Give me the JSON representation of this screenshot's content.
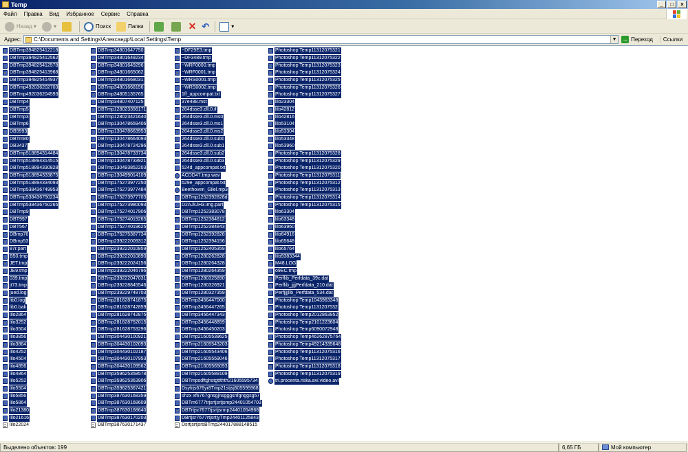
{
  "window": {
    "title": "Temp"
  },
  "menu": [
    "Файл",
    "Правка",
    "Вид",
    "Избранное",
    "Сервис",
    "Справка"
  ],
  "toolbar": {
    "back": "Назад",
    "search": "Поиск",
    "folders": "Папки"
  },
  "address": {
    "label": "Адрес:",
    "path": "C:\\Documents and Settings\\Александр\\Local Settings\\Temp",
    "go": "Переход",
    "links": "Ссылки"
  },
  "colors": {
    "selection": "#0a246a",
    "titlebar": "#0a246a",
    "face": "#ece9d8"
  },
  "columns": [
    [
      {
        "n": "DBTmp394825412218",
        "s": true
      },
      {
        "n": "DBTmp394825412562",
        "s": true
      },
      {
        "n": "DBTmp394825412578",
        "s": true
      },
      {
        "n": "DBTmp394825413968",
        "s": true
      },
      {
        "n": "DBTmp394825414937",
        "s": true
      },
      {
        "n": "DBTmp492036202703",
        "s": true
      },
      {
        "n": "DBTmp492036204593",
        "s": true
      },
      {
        "n": "DBTmp4",
        "s": true
      },
      {
        "n": "DBTmp5",
        "s": true
      },
      {
        "n": "DBTmp3",
        "s": true
      },
      {
        "n": "DBTmp6",
        "s": true
      },
      {
        "n": "DB9993",
        "s": true
      },
      {
        "n": "DBTm80",
        "s": true
      },
      {
        "n": "DB3437",
        "s": true
      },
      {
        "n": "DBTmp518894314484",
        "s": true
      },
      {
        "n": "DBTmp518894314515",
        "s": true
      },
      {
        "n": "DBTmp518894330828",
        "s": true
      },
      {
        "n": "DBTmp518894333875",
        "s": true
      },
      {
        "n": "DBTmp518894334093",
        "s": true
      },
      {
        "n": "DBTmp538436749953",
        "s": true
      },
      {
        "n": "DBTmp538436750234",
        "s": true
      },
      {
        "n": "DBTmp538436750265",
        "s": true
      },
      {
        "n": "DBTmp9",
        "s": true
      },
      {
        "n": "DBT997",
        "s": true
      },
      {
        "n": "DBT567",
        "s": true
      },
      {
        "n": "DBmp76",
        "s": true
      },
      {
        "n": "DBmp53",
        "s": true
      },
      {
        "n": "87r.part",
        "s": true
      },
      {
        "n": "B50.tmp",
        "s": true
      },
      {
        "n": "JET.tmp",
        "s": true
      },
      {
        "n": "JE9.tmp",
        "s": true
      },
      {
        "n": "039.tmp",
        "s": true
      },
      {
        "n": "jt73.tmp",
        "s": true
      },
      {
        "n": "jued.log",
        "s": true
      },
      {
        "n": "lib0.log",
        "s": true
      },
      {
        "n": "lib0.bak",
        "s": true
      },
      {
        "n": "lilo2864",
        "s": true
      },
      {
        "n": "lilo3252",
        "s": true
      },
      {
        "n": "lilo3504",
        "s": true
      },
      {
        "n": "lilo3856",
        "s": true
      },
      {
        "n": "lilo3864",
        "s": true
      },
      {
        "n": "lilo4252",
        "s": true
      },
      {
        "n": "lilo4504",
        "s": true
      },
      {
        "n": "lilo4856",
        "s": true
      },
      {
        "n": "lilo4864",
        "s": true
      },
      {
        "n": "lilo5252",
        "s": true
      },
      {
        "n": "lilo5504",
        "s": true
      },
      {
        "n": "lilo5856",
        "s": true
      },
      {
        "n": "lilo5864",
        "s": true
      },
      {
        "n": "lilo21380",
        "s": true
      },
      {
        "n": "lilo21616",
        "s": true
      },
      {
        "n": "lilo22024",
        "s": false
      }
    ],
    [
      {
        "n": "DBTmp34801647750",
        "s": true
      },
      {
        "n": "DBTmp34801649234",
        "s": true
      },
      {
        "n": "DBTmp34801649296",
        "s": true
      },
      {
        "n": "DBTmp34801665062",
        "s": true
      },
      {
        "n": "DBTmp34801668031",
        "s": true
      },
      {
        "n": "DBTmp34801668156",
        "s": true
      },
      {
        "n": "DBTmp34805135765",
        "s": true
      },
      {
        "n": "DBTmp34807407125",
        "s": true
      },
      {
        "n": "DBTmp128023356171",
        "s": true
      },
      {
        "n": "DBTmp128023421640",
        "s": true
      },
      {
        "n": "DBTmp130478659406",
        "s": true
      },
      {
        "n": "DBTmp130478663953",
        "s": true
      },
      {
        "n": "DBTmp130478664093",
        "s": true
      },
      {
        "n": "DBTmp130478724296",
        "s": true
      },
      {
        "n": "DBTmp130478733734",
        "s": true
      },
      {
        "n": "DBTmp130478733921",
        "s": true
      },
      {
        "n": "DBTmp130493852203",
        "s": true
      },
      {
        "n": "DBTmp130499014109",
        "s": true
      },
      {
        "n": "DBTmp175273977250",
        "s": true
      },
      {
        "n": "DBTmp175273977484",
        "s": true
      },
      {
        "n": "DBTmp175273977703",
        "s": true
      },
      {
        "n": "DBTmp175273980093",
        "s": true
      },
      {
        "n": "DBTmp175274017906",
        "s": true
      },
      {
        "n": "DBTmp175274019265",
        "s": true
      },
      {
        "n": "DBTmp175274019625",
        "s": true
      },
      {
        "n": "DBTmp175275387734",
        "s": true
      },
      {
        "n": "DBTmp239222009312",
        "s": true
      },
      {
        "n": "DBTmp239222010859",
        "s": true
      },
      {
        "n": "DBTmp239222010890",
        "s": true
      },
      {
        "n": "DBTmp239222024156",
        "s": true
      },
      {
        "n": "DBTmp239222046796",
        "s": true
      },
      {
        "n": "DBTmp239222047031",
        "s": true
      },
      {
        "n": "DBTmp239228845546",
        "s": true
      },
      {
        "n": "DBTmp239229748703",
        "s": true
      },
      {
        "n": "DBTmp281628741875",
        "s": true
      },
      {
        "n": "DBTmp281628742859",
        "s": true
      },
      {
        "n": "DBTmp281628742875",
        "s": true
      },
      {
        "n": "DBTmp281628752015",
        "s": true
      },
      {
        "n": "DBTmp281628753296",
        "s": true
      },
      {
        "n": "DBTmp304430100921",
        "s": true
      },
      {
        "n": "DBTmp304430102093",
        "s": true
      },
      {
        "n": "DBTmp304430102187",
        "s": true
      },
      {
        "n": "DBTmp304430107953",
        "s": true
      },
      {
        "n": "DBTmp304430109562",
        "s": true
      },
      {
        "n": "DBTmp359625358578",
        "s": true
      },
      {
        "n": "DBTmp359625363906",
        "s": true
      },
      {
        "n": "DBTmp359625367421",
        "s": true
      },
      {
        "n": "DBTmp387630168359",
        "s": true
      },
      {
        "n": "DBTmp387630168609",
        "s": true
      },
      {
        "n": "DBTmp387630168640",
        "s": true
      },
      {
        "n": "DBTmp387630170203",
        "s": true
      },
      {
        "n": "DBTmp387630171437",
        "s": false
      }
    ],
    [
      {
        "n": "~DF29E3.tmp",
        "s": true
      },
      {
        "n": "~DF3489.tmp",
        "s": true
      },
      {
        "n": "~WRF0000.tmp",
        "s": true
      },
      {
        "n": "~WRF0001.tmp",
        "s": true
      },
      {
        "n": "~WRS0001.tmp",
        "s": true
      },
      {
        "n": "~WRS0002.tmp",
        "s": true
      },
      {
        "n": "1ff_appcompat.txt",
        "s": true
      },
      {
        "n": "37e488.mst",
        "s": true
      },
      {
        "n": "264dsse3.dll.0.if",
        "s": true
      },
      {
        "n": "264dsse3.dll.0.ms0",
        "s": true
      },
      {
        "n": "264dsse3.dll.0.ms1",
        "s": true
      },
      {
        "n": "264dsse3.dll.0.ms2",
        "s": true
      },
      {
        "n": "264dsse3.dll.0.sub0",
        "s": true
      },
      {
        "n": "264dsse3.dll.0.sub1",
        "s": true
      },
      {
        "n": "264dsse3.dll.0.sub2",
        "s": true
      },
      {
        "n": "264dsse3.dll.0.sub3",
        "s": true
      },
      {
        "n": "524d_appcompat.txt",
        "s": true
      },
      {
        "n": "ACDD47.tmp.wav",
        "s": true,
        "t": "mp3"
      },
      {
        "n": "b29e_appcompat.txt",
        "s": true
      },
      {
        "n": "Beethoven_Gilel.mp3",
        "s": true,
        "t": "mp3"
      },
      {
        "n": "DBTmp1252392828d",
        "s": true
      },
      {
        "n": "D2AJkJH3.img.part",
        "s": true
      },
      {
        "n": "DBTmp1252383078",
        "s": true
      },
      {
        "n": "DBTmp1252384812",
        "s": true
      },
      {
        "n": "DBTmp1252384843",
        "s": true
      },
      {
        "n": "DBTmp1252392828",
        "s": true
      },
      {
        "n": "DBTmp1252394156",
        "s": true
      },
      {
        "n": "DBTmp1252405359",
        "s": true
      },
      {
        "n": "DBTmp1280262828",
        "s": true
      },
      {
        "n": "DBTmp1280264328",
        "s": true
      },
      {
        "n": "DBTmp1280264359",
        "s": true
      },
      {
        "n": "DBTmp1280325890",
        "s": true
      },
      {
        "n": "DBTmp1280326921",
        "s": true
      },
      {
        "n": "DBTmp1280327359",
        "s": true
      },
      {
        "n": "DBTmp3456447000",
        "s": true
      },
      {
        "n": "DBTmp3456447265",
        "s": true
      },
      {
        "n": "DBTmp3456447343",
        "s": true
      },
      {
        "n": "DBTmp3456448859",
        "s": true
      },
      {
        "n": "DBTmp3456450203",
        "s": true
      },
      {
        "n": "DBTmp21605539625",
        "s": true
      },
      {
        "n": "DBTmp21605543203",
        "s": true
      },
      {
        "n": "DBTmp21605543406",
        "s": true
      },
      {
        "n": "DBTmp21605559046",
        "s": true
      },
      {
        "n": "DBTmp21605565093",
        "s": true
      },
      {
        "n": "DBTmp21605589109",
        "s": true
      },
      {
        "n": "DBTmpsdftghstgttthth21605595734",
        "s": true
      },
      {
        "n": "Dsyfrjs676yr8Tmp21stjsj605595968",
        "s": true
      },
      {
        "n": "shzx xf6767gnsgjnsgggsnfgnggsg57",
        "s": true
      },
      {
        "n": "DBTm6777trjsrtjsrtjsmp24401054703",
        "s": true
      },
      {
        "n": "DBTrtjsr7677tjsrtjsrmp24401054968",
        "s": true
      },
      {
        "n": "DBrtjsr7677rtjsrtjyTmp24401125843",
        "s": true
      },
      {
        "n": "DsrtjsrtjsrsBTmp244017888148515",
        "s": false
      }
    ],
    [
      {
        "n": "Photoshop Temp11312075321",
        "s": true
      },
      {
        "n": "Photoshop Temp11312075322",
        "s": true
      },
      {
        "n": "Photoshop Temp11312075323",
        "s": true
      },
      {
        "n": "Photoshop Temp11312075324",
        "s": true
      },
      {
        "n": "Photoshop Temp11312075325",
        "s": true
      },
      {
        "n": "Photoshop Temp11312075326",
        "s": true
      },
      {
        "n": "Photoshop Temp11312075327",
        "s": true
      },
      {
        "n": "lilo23304",
        "s": true
      },
      {
        "n": "lilo42812",
        "s": true
      },
      {
        "n": "lilo42816",
        "s": true
      },
      {
        "n": "lilo53104",
        "s": true
      },
      {
        "n": "lilo53304",
        "s": true
      },
      {
        "n": "lilo53348",
        "s": true
      },
      {
        "n": "lilo53960",
        "s": true
      },
      {
        "n": "Photoshop Temp11312075328",
        "s": true
      },
      {
        "n": "Photoshop Temp11312075329",
        "s": true
      },
      {
        "n": "Photoshop Temp11312075320",
        "s": true
      },
      {
        "n": "Photoshop Temp11312075311",
        "s": true
      },
      {
        "n": "Photoshop Temp11312075312",
        "s": true
      },
      {
        "n": "Photoshop Temp11312075313",
        "s": true
      },
      {
        "n": "Photoshop Temp11312075314",
        "s": true
      },
      {
        "n": "Photoshop Temp11312075315",
        "s": true
      },
      {
        "n": "lilo63304",
        "s": true
      },
      {
        "n": "lilo63348",
        "s": true
      },
      {
        "n": "lilo63960",
        "s": true
      },
      {
        "n": "lilo64916",
        "s": true
      },
      {
        "n": "lilo65648",
        "s": true
      },
      {
        "n": "lilo65764",
        "s": true
      },
      {
        "n": "lilo9383344",
        "s": true
      },
      {
        "n": "M48.LOG",
        "s": true
      },
      {
        "n": "o9EC.tmp",
        "s": true
      },
      {
        "n": "Perflib_Perfdata_39c.dat",
        "s": true
      },
      {
        "n": "Perflib_jjjjPerfdata_210.dat",
        "s": true
      },
      {
        "n": "Perfjjjjlib_Perfdata_534.dat",
        "s": true
      },
      {
        "n": "Photoshop Temp1043963348",
        "s": true
      },
      {
        "n": "Photoshop Temp1131207532",
        "s": true
      },
      {
        "n": "Photoshop Temp2012863952",
        "s": true
      },
      {
        "n": "Photoshop Temp2101223604",
        "s": true
      },
      {
        "n": "Photoshop Temp6090072948",
        "s": true
      },
      {
        "n": "Photoshop Temp46262875764",
        "s": true
      },
      {
        "n": "Photoshop Temp49214335648",
        "s": true
      },
      {
        "n": "Photoshop Temp11312075316",
        "s": true
      },
      {
        "n": "Photoshop Temp11312075317",
        "s": true
      },
      {
        "n": "Photoshop Temp11312075318",
        "s": true
      },
      {
        "n": "Photoshop Temp11312075319",
        "s": true
      },
      {
        "n": "tri.procenta.riska.avi.video.avi",
        "s": true,
        "t": "mp3"
      }
    ]
  ],
  "status": {
    "selected": "Выделено объектов: 199",
    "size": "6,65 ГБ",
    "location": "Мой компьютер"
  }
}
